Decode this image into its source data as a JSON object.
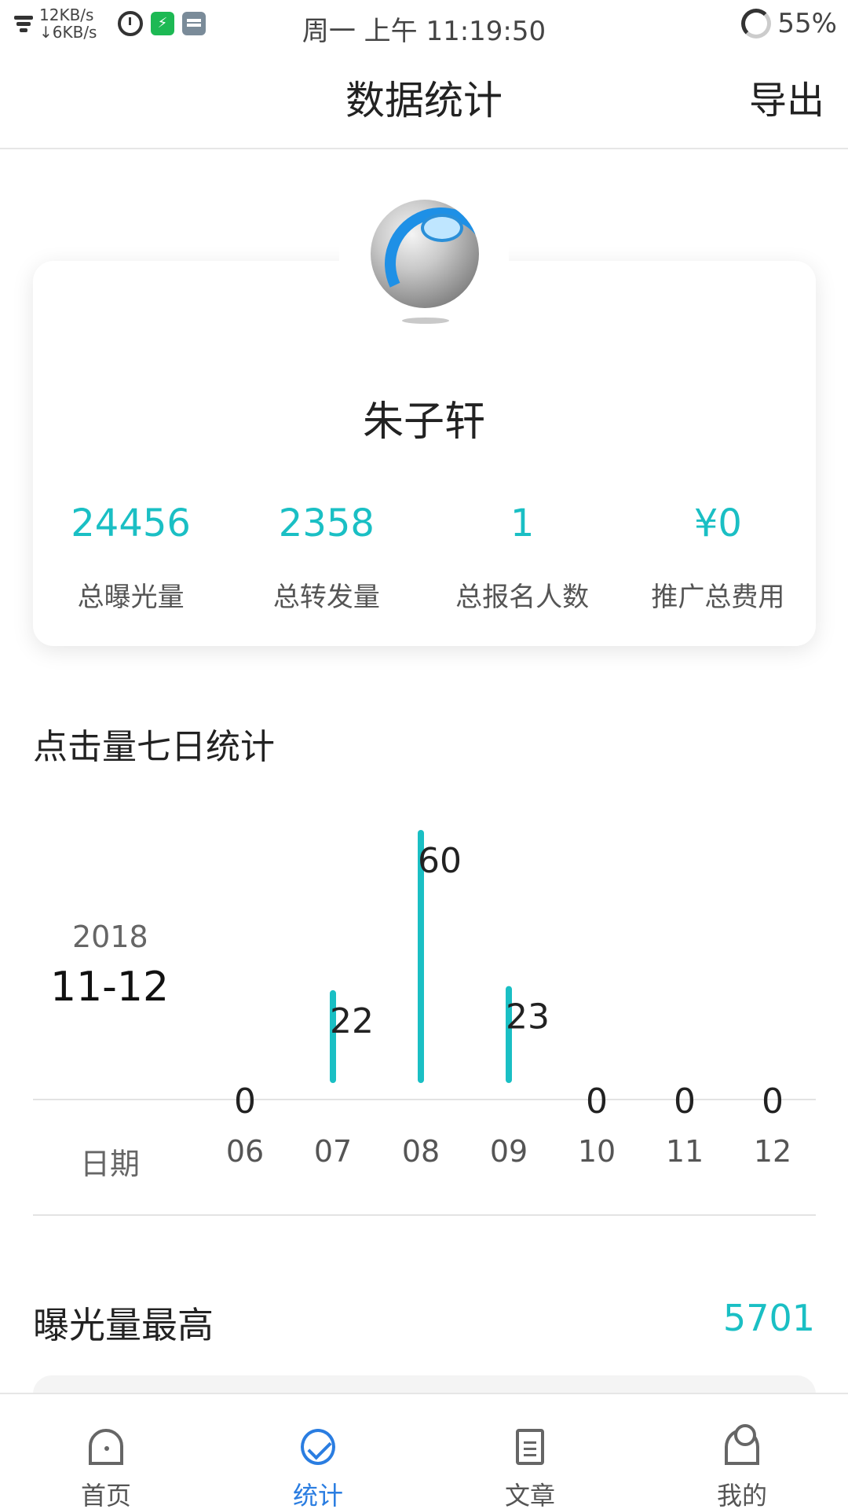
{
  "status_bar": {
    "up_speed": "12KB/s",
    "down_speed": "↓6KB/s",
    "time": "周一 上午 11:19:50",
    "battery": "55%"
  },
  "header": {
    "title": "数据统计",
    "export": "导出"
  },
  "profile": {
    "name": "朱子轩",
    "stats": [
      {
        "value": "24456",
        "label": "总曝光量"
      },
      {
        "value": "2358",
        "label": "总转发量"
      },
      {
        "value": "1",
        "label": "总报名人数"
      },
      {
        "value": "¥0",
        "label": "推广总费用"
      }
    ]
  },
  "chart_section": {
    "title": "点击量七日统计",
    "year": "2018",
    "date": "11-12",
    "x_label": "日期"
  },
  "chart_data": {
    "type": "bar",
    "categories": [
      "06",
      "07",
      "08",
      "09",
      "10",
      "11",
      "12"
    ],
    "values": [
      0,
      22,
      60,
      23,
      0,
      0,
      0
    ],
    "title": "点击量七日统计",
    "xlabel": "日期",
    "ylabel": "",
    "ylim": [
      0,
      60
    ],
    "color": "#1abfc4"
  },
  "highest": {
    "label": "曝光量最高",
    "value": "5701"
  },
  "nav": {
    "items": [
      {
        "label": "首页",
        "icon": "home-icon"
      },
      {
        "label": "统计",
        "icon": "stats-icon"
      },
      {
        "label": "文章",
        "icon": "document-icon"
      },
      {
        "label": "我的",
        "icon": "user-icon"
      }
    ],
    "active_color": "#2a7de1"
  }
}
